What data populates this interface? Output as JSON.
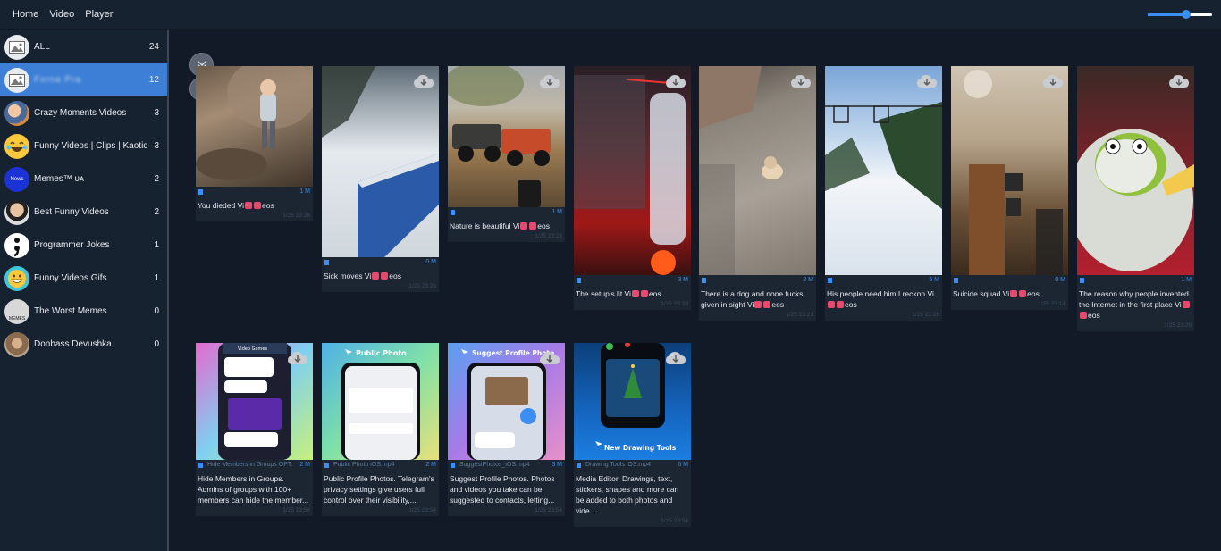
{
  "menu": {
    "home": "Home",
    "video": "Video",
    "player": "Player"
  },
  "zoom": {
    "value": 0.6
  },
  "sidebar": {
    "items": [
      {
        "label": "ALL",
        "count": "24"
      },
      {
        "label": "Fxrna Pra",
        "count": "12"
      },
      {
        "label": "Crazy Moments Videos",
        "count": "3"
      },
      {
        "label": "Funny Videos | Clips | Kaotic",
        "count": "3"
      },
      {
        "label": "Memes™ ᴜᴀ",
        "count": "2",
        "avatar_text": "News"
      },
      {
        "label": "Best Funny Videos",
        "count": "2"
      },
      {
        "label": "Programmer Jokes",
        "count": "1"
      },
      {
        "label": "Funny Videos Gifs",
        "count": "1"
      },
      {
        "label": "The Worst Memes",
        "count": "0",
        "avatar_text": "MEMES"
      },
      {
        "label": "Donbass Devushka",
        "count": "0"
      }
    ]
  },
  "cards": [
    {
      "filename": "",
      "size": "1 M",
      "caption_before": "You dieded Vi",
      "caption_after": "eos",
      "date": "1/25 23:26"
    },
    {
      "filename": "",
      "size": "0 M",
      "caption_before": "Sick moves Vi",
      "caption_after": "eos",
      "date": "1/25 23:26"
    },
    {
      "filename": "",
      "size": "1 M",
      "caption_before": "Nature is beautiful Vi",
      "caption_after": "eos",
      "date": "1/25 23:23"
    },
    {
      "filename": "",
      "size": "3 M",
      "caption_before": "The setup's lit Vi",
      "caption_after": "eos",
      "date": "1/25 23:33"
    },
    {
      "filename": "",
      "size": "2 M",
      "caption_before": "There is a dog and none fucks given in sight Vi",
      "caption_after": "eos",
      "date": "1/25 23:21"
    },
    {
      "filename": "",
      "size": "5 M",
      "caption_before": "His people need him I reckon Vi",
      "caption_after": "eos",
      "date": "1/25 23:26"
    },
    {
      "filename": "",
      "size": "0 M",
      "caption_before": "Suicide squad Vi",
      "caption_after": "eos",
      "date": "1/25 23:14"
    },
    {
      "filename": "",
      "size": "1 M",
      "caption_before": "The reason why people invented the Internet in the first place Vi",
      "caption_after": "eos",
      "date": "1/25 23:26"
    },
    {
      "filename": "Hide Members in Groups OPT...",
      "size": "2 M",
      "caption_before": "Hide Members in Groups. Admins of groups with 100+ members can hide the member...",
      "caption_after": "",
      "date": "1/25 23:54"
    },
    {
      "filename": "Public Photo iOS.mp4",
      "size": "2 M",
      "caption_before": "Public Profile Photos. Telegram's privacy settings give users full control over their visibility,...",
      "caption_after": "",
      "date": "1/25 23:54"
    },
    {
      "filename": "SuggestPhotos_iOS.mp4",
      "size": "3 M",
      "caption_before": "Suggest Profile Photos. Photos and videos you take can be suggested to contacts, letting...",
      "caption_after": "",
      "date": "1/25 23:54"
    },
    {
      "filename": "Drawing Tools iOS.mp4",
      "size": "6 M",
      "caption_before": "Media Editor. Drawings, text, stickers, shapes and more can be added to both photos and vide...",
      "caption_after": "",
      "date": "1/25 23:54"
    }
  ],
  "thumbs": {
    "public_photo": "Public Photo",
    "suggest_photo": "Suggest Profile Photo",
    "drawing_tools": "New Drawing Tools",
    "video_games": "Video Games"
  },
  "colors": {
    "accent": "#3b8ef3",
    "sidebar_active": "#3d7fd6",
    "background": "#111a26"
  }
}
